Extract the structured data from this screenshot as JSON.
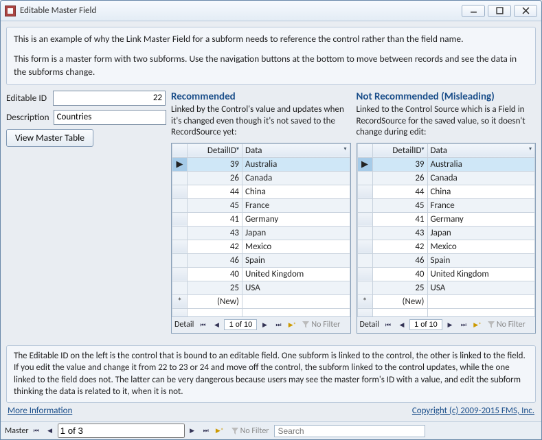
{
  "window": {
    "title": "Editable Master Field"
  },
  "intro": {
    "p1": "This is an example of why the Link Master Field for a subform needs to reference the control rather than the field name.",
    "p2": "This form is a master form with two subforms. Use the navigation buttons at the bottom to move between records and see the data in the subforms change."
  },
  "form": {
    "editable_id_label": "Editable ID",
    "editable_id_value": "22",
    "description_label": "Description",
    "description_value": "Countries",
    "view_master_label": "View Master Table"
  },
  "panels": {
    "left": {
      "title": "Recommended",
      "desc": "Linked by the Control's value and updates when it's changed even though it's not saved to the RecordSource yet:"
    },
    "right": {
      "title": "Not Recommended (Misleading)",
      "desc": "Linked to the Control Source which is a Field in RecordSource for the saved value, so it doesn't change during edit:"
    }
  },
  "grid": {
    "col_id": "DetailID",
    "col_data": "Data",
    "rows": [
      {
        "id": 39,
        "data": "Australia"
      },
      {
        "id": 26,
        "data": "Canada"
      },
      {
        "id": 44,
        "data": "China"
      },
      {
        "id": 45,
        "data": "France"
      },
      {
        "id": 41,
        "data": "Germany"
      },
      {
        "id": 43,
        "data": "Japan"
      },
      {
        "id": 42,
        "data": "Mexico"
      },
      {
        "id": 46,
        "data": "Spain"
      },
      {
        "id": 40,
        "data": "United Kingdom"
      },
      {
        "id": 25,
        "data": "USA"
      }
    ],
    "new_label": "(New)",
    "recnav": {
      "label": "Detail",
      "position": "1 of 10",
      "filter": "No Filter"
    }
  },
  "footer": {
    "text": "The Editable ID on the left is the control that is bound to an editable field. One subform is linked to the control, the other is linked to the field. If you edit the value and change it from 22 to 23 or 24 and move off the control, the subform linked to the control updates, while the one linked to the field does not.  The latter can be very dangerous because users may see the master form's ID with a value, and edit the subform thinking the data is related to it, when it is not."
  },
  "links": {
    "more_info": "More Information",
    "copyright": "Copyright (c) 2009-2015 FMS, Inc."
  },
  "master_nav": {
    "label": "Master",
    "position": "1 of 3",
    "filter": "No Filter",
    "search_placeholder": "Search"
  }
}
